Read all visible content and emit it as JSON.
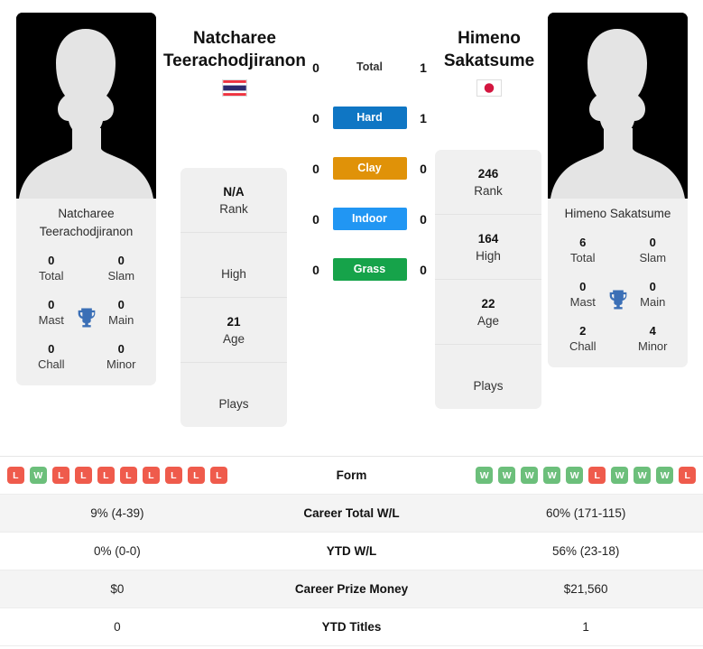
{
  "players": {
    "left": {
      "first_name": "Natcharee",
      "last_name": "Teerachodjiranon",
      "full_name": "Natcharee Teerachodjiranon",
      "photo_caption_line1": "Natcharee",
      "photo_caption_line2": "Teerachodjiranon",
      "country_flag": "thailand-flag",
      "titles": [
        {
          "value": "0",
          "label": "Total"
        },
        {
          "value": "0",
          "label": "Slam"
        },
        {
          "value": "0",
          "label": "Mast"
        },
        {
          "value": "0",
          "label": "Main"
        },
        {
          "value": "0",
          "label": "Chall"
        },
        {
          "value": "0",
          "label": "Minor"
        }
      ],
      "info": [
        {
          "value": "N/A",
          "label": "Rank"
        },
        {
          "value": "",
          "label": "High"
        },
        {
          "value": "21",
          "label": "Age"
        },
        {
          "value": "",
          "label": "Plays"
        }
      ],
      "form": [
        "L",
        "W",
        "L",
        "L",
        "L",
        "L",
        "L",
        "L",
        "L",
        "L"
      ]
    },
    "right": {
      "first_name": "Himeno",
      "last_name": "Sakatsume",
      "full_name": "Himeno Sakatsume",
      "photo_caption_line1": "Himeno Sakatsume",
      "photo_caption_line2": "",
      "country_flag": "japan-flag",
      "titles": [
        {
          "value": "6",
          "label": "Total"
        },
        {
          "value": "0",
          "label": "Slam"
        },
        {
          "value": "0",
          "label": "Mast"
        },
        {
          "value": "0",
          "label": "Main"
        },
        {
          "value": "2",
          "label": "Chall"
        },
        {
          "value": "4",
          "label": "Minor"
        }
      ],
      "info": [
        {
          "value": "246",
          "label": "Rank"
        },
        {
          "value": "164",
          "label": "High"
        },
        {
          "value": "22",
          "label": "Age"
        },
        {
          "value": "",
          "label": "Plays"
        }
      ],
      "form": [
        "W",
        "W",
        "W",
        "W",
        "W",
        "L",
        "W",
        "W",
        "W",
        "L"
      ]
    }
  },
  "head_to_head": [
    {
      "label": "Total",
      "left": "0",
      "right": "1",
      "color": "",
      "style": "plain"
    },
    {
      "label": "Hard",
      "left": "0",
      "right": "1",
      "color": "#0f76c4",
      "style": "surf"
    },
    {
      "label": "Clay",
      "left": "0",
      "right": "0",
      "color": "#e09208",
      "style": "surf"
    },
    {
      "label": "Indoor",
      "left": "0",
      "right": "0",
      "color": "#2196f3",
      "style": "surf"
    },
    {
      "label": "Grass",
      "left": "0",
      "right": "0",
      "color": "#16a34a",
      "style": "surf"
    }
  ],
  "comparison_rows": [
    {
      "label": "Form",
      "left": "",
      "right": "",
      "type": "form"
    },
    {
      "label": "Career Total W/L",
      "left": "9% (4-39)",
      "right": "60% (171-115)",
      "type": "text"
    },
    {
      "label": "YTD W/L",
      "left": "0% (0-0)",
      "right": "56% (23-18)",
      "type": "text"
    },
    {
      "label": "Career Prize Money",
      "left": "$0",
      "right": "$21,560",
      "type": "text"
    },
    {
      "label": "YTD Titles",
      "left": "0",
      "right": "1",
      "type": "text"
    }
  ],
  "colors": {
    "win_badge": "#6cbf7b",
    "loss_badge": "#ef5b4c",
    "trophy": "#3b6fb6",
    "card_bg": "#f0f0f0"
  }
}
